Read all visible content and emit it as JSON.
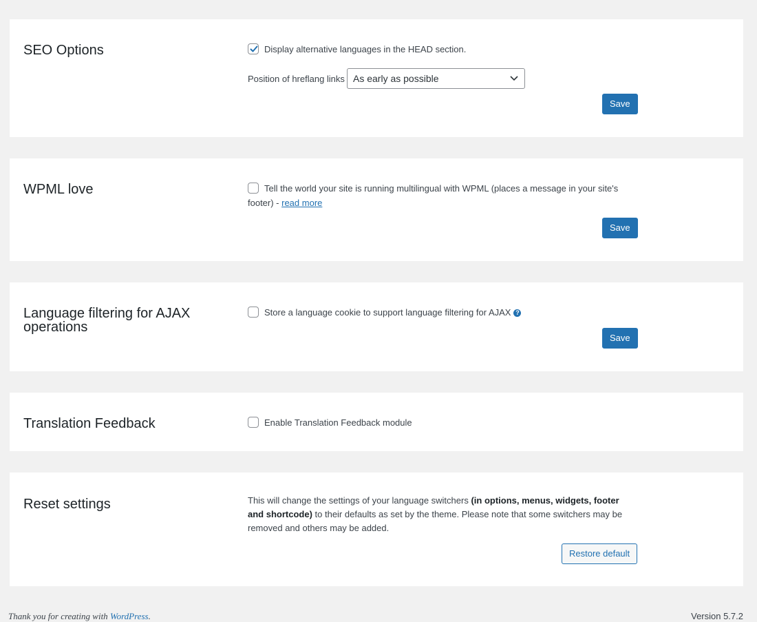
{
  "seo": {
    "title": "SEO Options",
    "display_alt_label": "Display alternative languages in the HEAD section.",
    "display_alt_checked": true,
    "position_label": "Position of hreflang links",
    "position_value": "As early as possible",
    "save_label": "Save"
  },
  "wpml_love": {
    "title": "WPML love",
    "tell_label": "Tell the world your site is running multilingual with WPML (places a message in your site's footer) - ",
    "read_more": "read more",
    "save_label": "Save"
  },
  "ajax": {
    "title": "Language filtering for AJAX operations",
    "cookie_label": "Store a language cookie to support language filtering for AJAX",
    "help_glyph": "?",
    "save_label": "Save"
  },
  "feedback": {
    "title": "Translation Feedback",
    "enable_label": "Enable Translation Feedback module"
  },
  "reset": {
    "title": "Reset settings",
    "text_before": "This will change the settings of your language switchers ",
    "text_bold": "(in options, menus, widgets, footer and shortcode)",
    "text_after": " to their defaults as set by the theme. Please note that some switchers may be removed and others may be added.",
    "restore_label": "Restore default"
  },
  "footer": {
    "thanks_prefix": "Thank you for creating with ",
    "wordpress_link": "WordPress",
    "thanks_suffix": ".",
    "version": "Version 5.7.2"
  },
  "colors": {
    "accent": "#2271b1",
    "background": "#f1f1f1",
    "panel": "#ffffff"
  }
}
